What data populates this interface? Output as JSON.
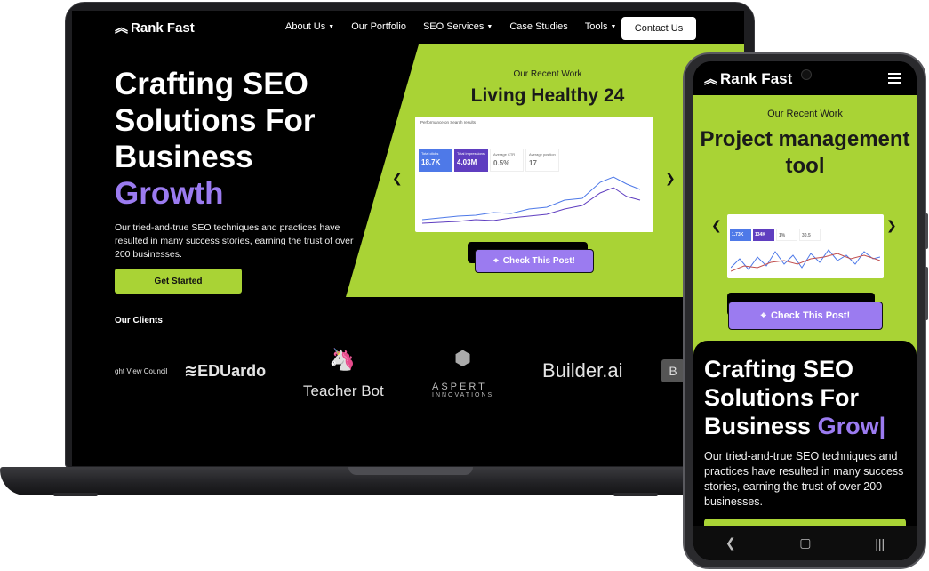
{
  "brand": {
    "name": "Rank Fast",
    "accent_green": "#a9d335",
    "accent_purple": "#9b7bf0"
  },
  "nav": {
    "items": [
      {
        "label": "About Us",
        "has_dropdown": true
      },
      {
        "label": "Our Portfolio",
        "has_dropdown": false
      },
      {
        "label": "SEO Services",
        "has_dropdown": true
      },
      {
        "label": "Case Studies",
        "has_dropdown": false
      },
      {
        "label": "Tools",
        "has_dropdown": true
      }
    ],
    "contact_label": "Contact Us"
  },
  "hero": {
    "title_line1": "Crafting SEO",
    "title_line2": "Solutions For",
    "title_line3": "Business",
    "title_accent": "Growth",
    "description": "Our tried-and-true SEO techniques and practices have resulted in many success stories, earning the trust of over 200 businesses.",
    "cta_label": "Get Started"
  },
  "recent_work": {
    "kicker": "Our Recent Work",
    "title": "Living Healthy 24",
    "cta_label": "Check This Post!",
    "screenshot": {
      "header": "Performance on Search results",
      "metrics": [
        {
          "label": "Total clicks",
          "value": "18.7K"
        },
        {
          "label": "Total impressions",
          "value": "4.03M"
        },
        {
          "label": "Average CTR",
          "value": "0.5%"
        },
        {
          "label": "Average position",
          "value": "17"
        }
      ]
    }
  },
  "clients": {
    "heading": "Our Clients",
    "logos": [
      "ght View Council",
      "EDUardo",
      "Teacher Bot",
      "ASPERT",
      "INNOVATIONS",
      "Builder.ai",
      "B"
    ]
  },
  "mobile": {
    "brand": "Rank Fast",
    "recent_work_kicker": "Our Recent Work",
    "recent_work_title": "Project management tool",
    "cta_label": "Check This Post!",
    "screenshot_metrics": [
      "1.73K",
      "134K",
      "1%",
      "30.5"
    ],
    "hero_title_line1": "Crafting SEO",
    "hero_title_line2": "Solutions For",
    "hero_title_line3": "Business",
    "hero_title_accent": "Grow|",
    "hero_description": "Our tried-and-true SEO techniques and practices have resulted in many success stories, earning the trust of over 200 businesses."
  }
}
